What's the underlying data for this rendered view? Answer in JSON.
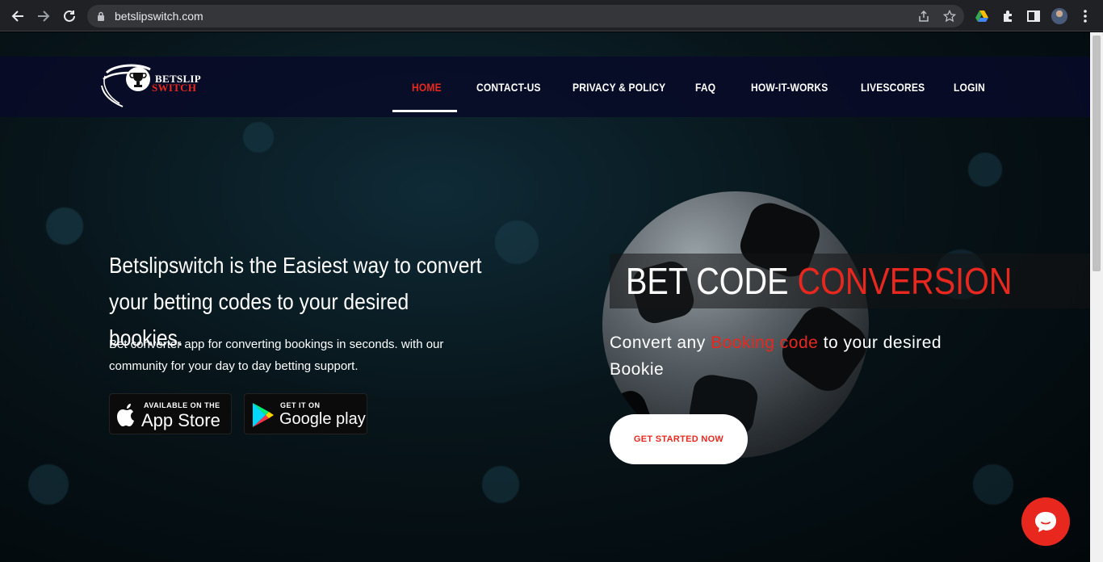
{
  "browser": {
    "url": "betslipswitch.com"
  },
  "site": {
    "logo_line1": "BETSLIP",
    "logo_line2": "SWITCH",
    "nav": [
      {
        "label": "HOME",
        "active": true
      },
      {
        "label": "CONTACT-US"
      },
      {
        "label": "PRIVACY & POLICY"
      },
      {
        "label": "FAQ"
      },
      {
        "label": "HOW-IT-WORKS"
      },
      {
        "label": "LIVESCORES"
      },
      {
        "label": "LOGIN"
      }
    ]
  },
  "hero": {
    "headline": "Betslipswitch is the Easiest way to convert your betting codes to your desired bookies.",
    "subtext": "Bet converter app for converting bookings in seconds. with our community for your day to day betting support.",
    "appstore_small": "AVAILABLE ON THE",
    "appstore_big": "App Store",
    "googleplay_small": "GET IT ON",
    "googleplay_big": "Google play"
  },
  "promo": {
    "title_white": "BET CODE",
    "title_red": "CONVERSION",
    "sub_before": "Convert any",
    "sub_red": "Booking code",
    "sub_after": "to your desired Bookie",
    "cta_label": "GET STARTED NOW"
  },
  "colors": {
    "accent": "#e8281e",
    "navbar": "#080a28"
  }
}
